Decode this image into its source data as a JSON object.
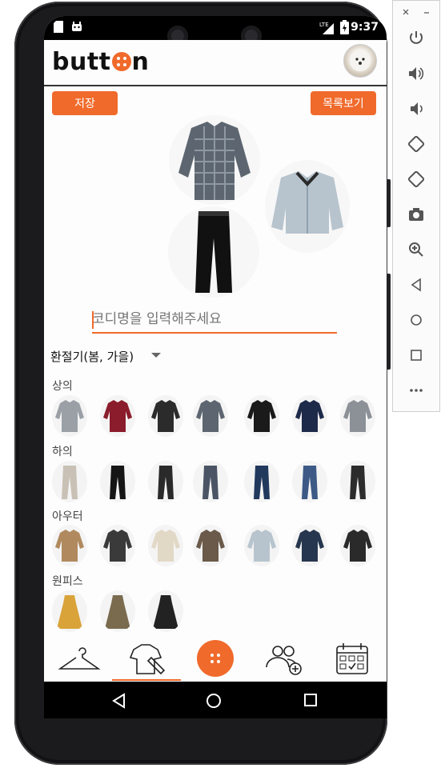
{
  "status_bar": {
    "time": "9:37",
    "network": "LTE"
  },
  "app": {
    "logo_text_before": "butt",
    "logo_text_after": "n"
  },
  "toolbar": {
    "save_label": "저장",
    "list_label": "목록보기"
  },
  "outfit_name_input": {
    "placeholder": "코디명을 입력해주세요",
    "value": ""
  },
  "season_select": {
    "selected": "환절기(봄, 가을)"
  },
  "categories": [
    {
      "label": "상의",
      "count": 7
    },
    {
      "label": "하의",
      "count": 7
    },
    {
      "label": "아우터",
      "count": 7
    },
    {
      "label": "원피스",
      "count": 3
    }
  ],
  "bottom_nav": {
    "items": [
      "hanger-icon",
      "shirt-pencil-icon",
      "button-logo-icon",
      "people-add-icon",
      "calendar-check-icon"
    ],
    "active_index": 1
  },
  "emulator_toolbar": {
    "items": [
      "power-icon",
      "volume-up-icon",
      "volume-down-icon",
      "rotate-left-icon",
      "rotate-right-icon",
      "camera-icon",
      "zoom-icon",
      "back-icon",
      "home-icon",
      "overview-icon",
      "more-icon"
    ]
  },
  "colors": {
    "accent": "#f06a2b"
  }
}
